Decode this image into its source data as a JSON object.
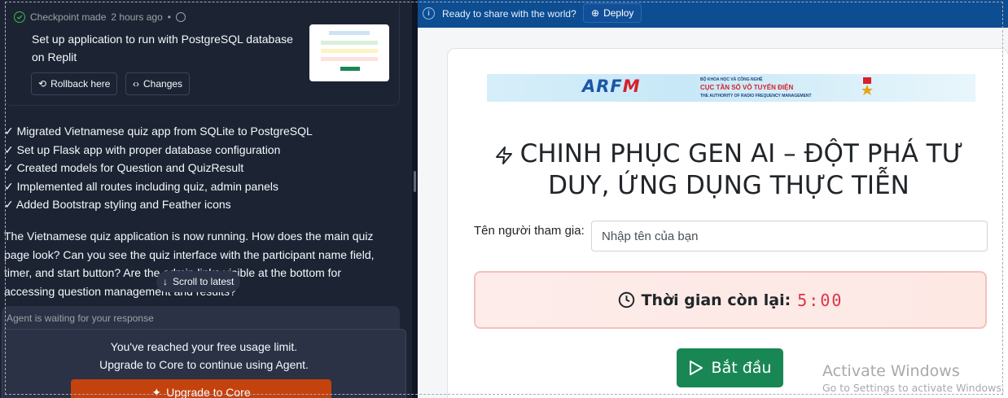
{
  "checkpoint": {
    "meta": "Checkpoint made",
    "time": "2 hours ago",
    "title": "Set up application to run with PostgreSQL database on Replit",
    "rollback_label": "Rollback here",
    "changes_label": "Changes"
  },
  "changes": [
    "Migrated Vietnamese quiz app from SQLite to PostgreSQL",
    "Set up Flask app with proper database configuration",
    "Created models for Question and QuizResult",
    "Implemented all routes including quiz, admin panels",
    "Added Bootstrap styling and Feather icons"
  ],
  "agent_message": "The Vietnamese quiz application is now running. How does the main quiz page look? Can you see the quiz interface with the participant name field, timer, and start button? Are the admin links visible at the bottom for accessing question management and results?",
  "scroll_label": "Scroll to latest",
  "waiting_label": "Agent is waiting for your response",
  "limit": {
    "line1": "You've reached your free usage limit.",
    "line2": "Upgrade to Core to continue using Agent.",
    "upgrade_label": "Upgrade to Core"
  },
  "deploy": {
    "text": "Ready to share with the world?",
    "button_label": "Deploy"
  },
  "banner": {
    "logo_blue": "ARF",
    "logo_red": "M",
    "ministry": "BỘ KHOA HỌC VÀ CÔNG NGHỆ",
    "agency": "CỤC TẦN SỐ VÔ TUYẾN ĐIỆN",
    "english": "THE AUTHORITY OF RADIO FREQUENCY MANAGEMENT"
  },
  "quiz": {
    "title": "CHINH PHỤC GEN AI – ĐỘT PHÁ TƯ DUY, ỨNG DỤNG THỰC TIỄN",
    "name_label": "Tên người tham gia:",
    "name_placeholder": "Nhập tên của bạn",
    "timer_label": "Thời gian còn lại:",
    "timer_value": "5:00",
    "start_label": "Bắt đầu"
  },
  "watermark": {
    "line1": "Activate Windows",
    "line2": "Go to Settings to activate Windows."
  },
  "colors": {
    "left_bg": "#1c2333",
    "deploy_bar": "#0d4d91",
    "upgrade": "#c4420e",
    "start": "#198754",
    "timer_value": "#dc3545"
  }
}
